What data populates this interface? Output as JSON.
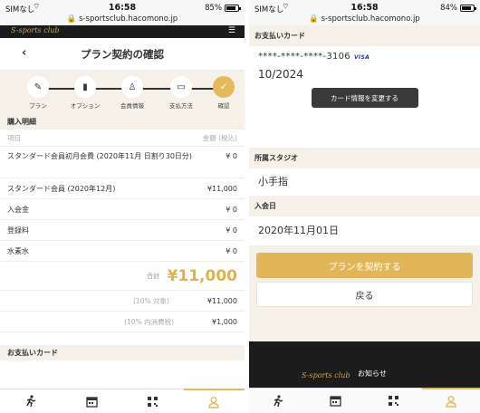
{
  "left": {
    "status": {
      "carrier": "SIMなし",
      "time": "16:58",
      "battery_text": "85%",
      "battery_level": 0.85,
      "url": "s-sportsclub.hacomono.jp"
    },
    "brand": "S-sports club",
    "page_title": "プラン契約の確認",
    "steps": [
      {
        "label": "プラン",
        "icon": "pen-icon"
      },
      {
        "label": "オプション",
        "icon": "bottle-icon"
      },
      {
        "label": "会員情報",
        "icon": "person-icon"
      },
      {
        "label": "支払方法",
        "icon": "card-icon"
      },
      {
        "label": "確認",
        "icon": "check-icon"
      }
    ],
    "section_title": "購入明細",
    "table_head": {
      "item": "項目",
      "amount": "金額 (税込)"
    },
    "items": [
      {
        "name": "スタンダード会員初月会費 (2020年11月 日割り30日分)",
        "amount": "¥ 0"
      },
      {
        "name": "スタンダード会員 (2020年12月)",
        "amount": "¥11,000"
      },
      {
        "name": "入会金",
        "amount": "¥ 0"
      },
      {
        "name": "登録料",
        "amount": "¥ 0"
      },
      {
        "name": "水素水",
        "amount": "¥ 0"
      }
    ],
    "total": {
      "label": "合計",
      "value": "¥11,000"
    },
    "tax": [
      {
        "label": "(10% 対象)",
        "value": "¥11,000"
      },
      {
        "label": "(10% 内消費税)",
        "value": "¥1,000"
      }
    ],
    "payment_section": "お支払いカード"
  },
  "right": {
    "status": {
      "carrier": "SIMなし",
      "time": "16:58",
      "battery_text": "84%",
      "battery_level": 0.84,
      "url": "s-sportsclub.hacomono.jp"
    },
    "payment_section": "お支払いカード",
    "card_number": "****-****-****-3106",
    "card_brand": "VISA",
    "card_expiry": "10/2024",
    "change_card_label": "カード情報を変更する",
    "studio_label": "所属スタジオ",
    "studio_value": "小手指",
    "join_label": "入会日",
    "join_value": "2020年11月01日",
    "contract_label": "プランを契約する",
    "back_label": "戻る",
    "footer_brand": "S-sports club",
    "footer_news": "お知らせ"
  },
  "colors": {
    "accent": "#e0b659",
    "beige": "#f5f1e8",
    "dark": "#1c1c1c"
  },
  "tabs": [
    "runner-icon",
    "calendar-icon",
    "qr-icon",
    "user-icon"
  ]
}
